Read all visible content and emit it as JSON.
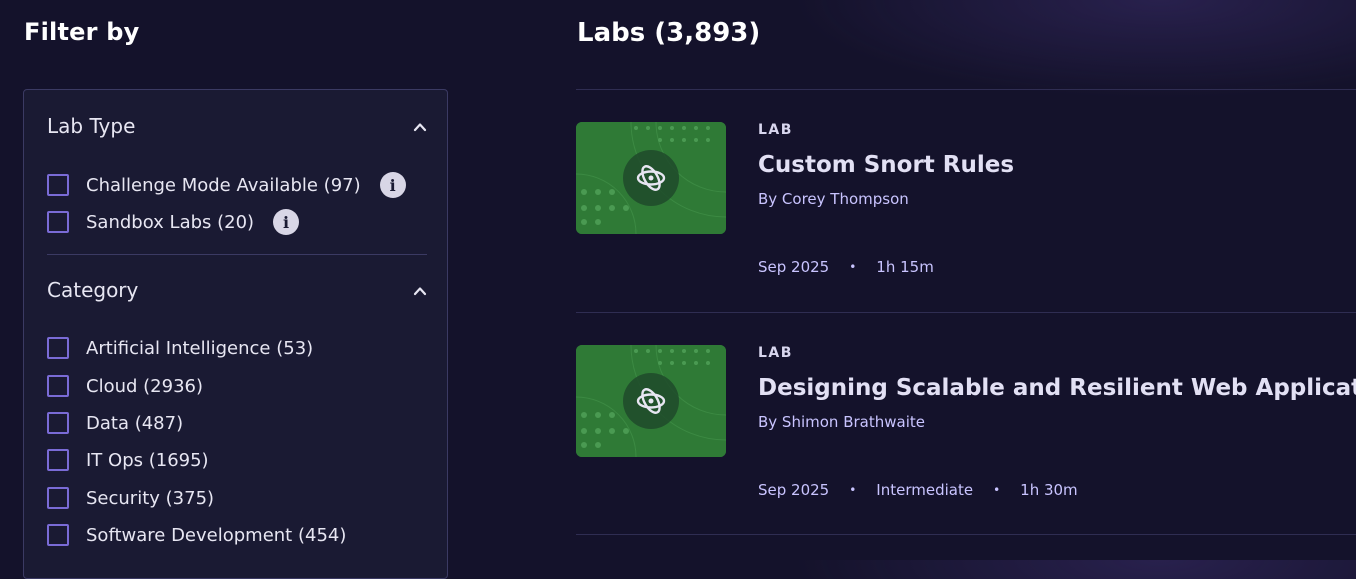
{
  "filters": {
    "title": "Filter by",
    "lab_type": {
      "title": "Lab Type",
      "options": [
        {
          "label": "Challenge Mode Available (97)",
          "checked": false,
          "info": true
        },
        {
          "label": "Sandbox Labs (20)",
          "checked": false,
          "info": true
        }
      ]
    },
    "category": {
      "title": "Category",
      "options": [
        {
          "label": "Artificial Intelligence (53)",
          "checked": false
        },
        {
          "label": "Cloud (2936)",
          "checked": false
        },
        {
          "label": "Data (487)",
          "checked": false
        },
        {
          "label": "IT Ops (1695)",
          "checked": false
        },
        {
          "label": "Security (375)",
          "checked": false
        },
        {
          "label": "Software Development (454)",
          "checked": false
        }
      ]
    }
  },
  "results": {
    "title": "Labs (3,893)",
    "cards": [
      {
        "type": "LAB",
        "title": "Custom Snort Rules",
        "author": "By Corey Thompson",
        "meta": [
          "Sep 2025",
          "1h 15m"
        ],
        "thumbnail_icon": "atom-icon"
      },
      {
        "type": "LAB",
        "title": "Designing Scalable and Resilient Web Applications",
        "author": "By Shimon Brathwaite",
        "meta": [
          "Sep 2025",
          "Intermediate",
          "1h 30m"
        ],
        "thumbnail_icon": "atom-icon"
      }
    ]
  },
  "colors": {
    "background": "#14122b",
    "panel": "#1a1a33",
    "accent": "#7a6bd6",
    "thumbnail": "#2f7a36",
    "meta_text": "#c9c4ff"
  }
}
